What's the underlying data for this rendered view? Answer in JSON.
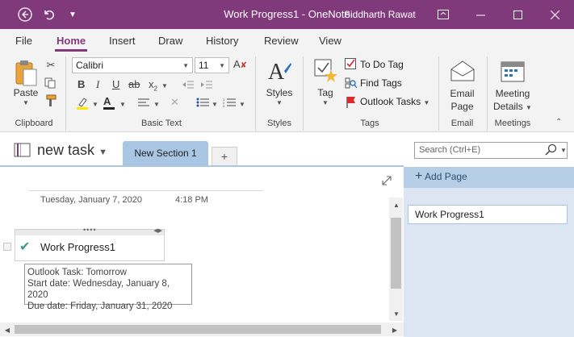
{
  "window": {
    "title": "Work Progress1  -  OneNote",
    "user": "Siddharth Rawat"
  },
  "menu": [
    "File",
    "Home",
    "Insert",
    "Draw",
    "History",
    "Review",
    "View"
  ],
  "ribbon": {
    "paste_label": "Paste",
    "font_name": "Calibri",
    "font_size": "11",
    "styles_label": "Styles",
    "tag_label": "Tag",
    "todo_tag": "To Do Tag",
    "find_tags": "Find Tags",
    "outlook_tasks": "Outlook Tasks",
    "email_line1": "Email",
    "email_line2": "Page",
    "meeting_line1": "Meeting",
    "meeting_line2": "Details",
    "groups": {
      "clipboard": "Clipboard",
      "basic_text": "Basic Text",
      "styles": "Styles",
      "tags": "Tags",
      "email": "Email",
      "meetings": "Meetings"
    }
  },
  "notebook": {
    "name": "new task",
    "section_tab": "New Section 1",
    "add_tab": "+",
    "search_placeholder": "Search (Ctrl+E)"
  },
  "page": {
    "date": "Tuesday, January 7, 2020",
    "time": "4:18 PM",
    "note_title": "Work Progress1",
    "tooltip": {
      "line1": "Outlook Task: Tomorrow",
      "line2": "Start date: Wednesday, January 8, 2020",
      "line3": "Due date: Friday, January 31, 2020"
    }
  },
  "pages_panel": {
    "add_page": "Add Page",
    "pages": [
      "Work Progress1"
    ]
  },
  "colors": {
    "titlebar": "#80397b",
    "section_tab": "#a9c7e4",
    "check": "#3a9e86"
  }
}
